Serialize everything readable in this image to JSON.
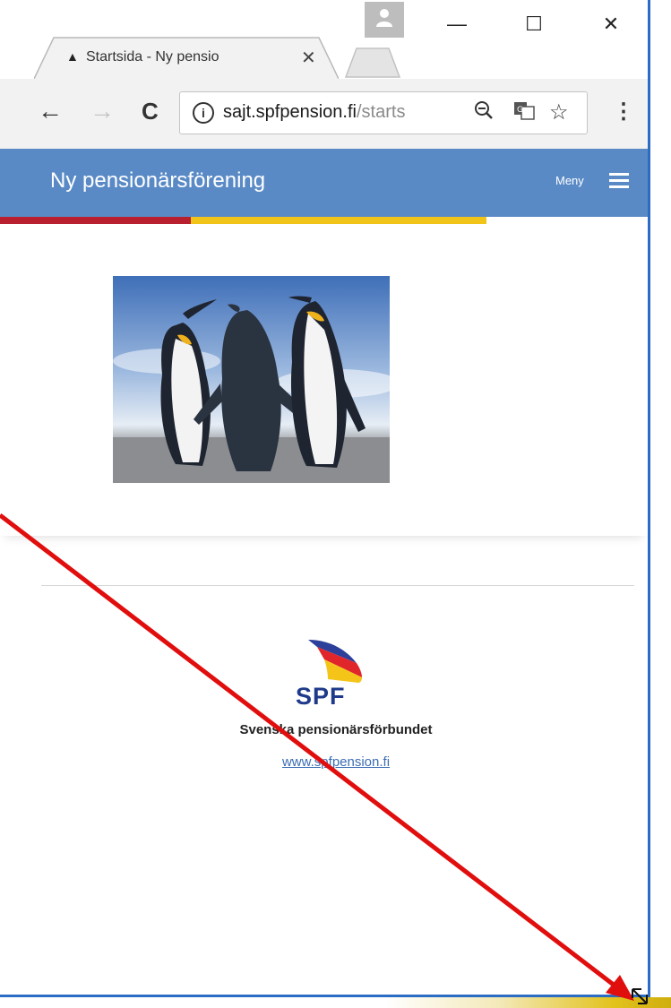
{
  "browser": {
    "tab": {
      "title": "Startsida - Ny pensio",
      "close": "✕"
    },
    "window_controls": {
      "minimize": "—",
      "maximize": "☐",
      "close": "✕"
    },
    "address": {
      "host": "sajt.spfpension.fi",
      "path": "/starts"
    },
    "nav": {
      "back": "←",
      "forward": "→",
      "reload": "C"
    }
  },
  "site": {
    "title": "Ny pensionärsförening",
    "menu_label": "Meny"
  },
  "footer": {
    "logo_text": "SPF",
    "organization": "Svenska pensionärsförbundet",
    "link": "www.spfpension.fi"
  },
  "colors": {
    "header": "#5a8ac6",
    "arrow": "#e10e0e",
    "window_border": "#2b6cc4"
  }
}
